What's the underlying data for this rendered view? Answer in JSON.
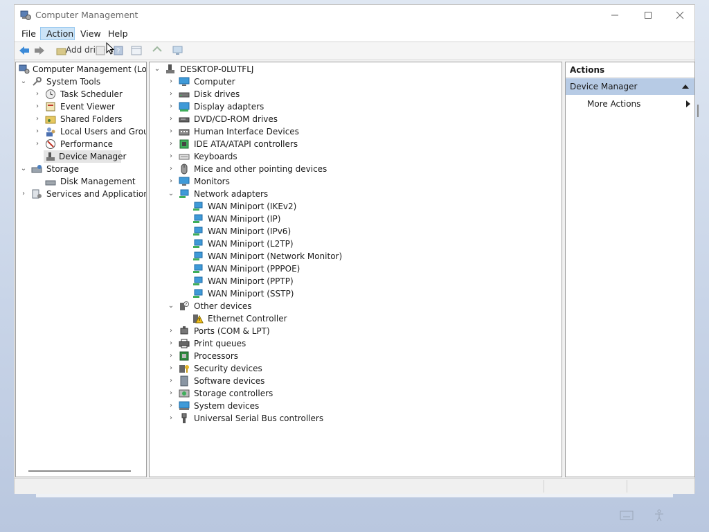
{
  "window": {
    "title": "Computer Management"
  },
  "menu": [
    "File",
    "Action",
    "View",
    "Help"
  ],
  "toolbar": {
    "tooltip": "Add drivers"
  },
  "left_tree": {
    "root": "Computer Management (Local",
    "system_tools": "System Tools",
    "items": [
      "Task Scheduler",
      "Event Viewer",
      "Shared Folders",
      "Local Users and Groups",
      "Performance",
      "Device Manager"
    ],
    "storage": "Storage",
    "disk_management": "Disk Management",
    "services": "Services and Applications"
  },
  "device_tree": {
    "root": "DESKTOP-0LUTFLJ",
    "before_network": [
      "Computer",
      "Disk drives",
      "Display adapters",
      "DVD/CD-ROM drives",
      "Human Interface Devices",
      "IDE ATA/ATAPI controllers",
      "Keyboards",
      "Mice and other pointing devices",
      "Monitors"
    ],
    "network_adapters": "Network adapters",
    "network_children": [
      "WAN Miniport (IKEv2)",
      "WAN Miniport (IP)",
      "WAN Miniport (IPv6)",
      "WAN Miniport (L2TP)",
      "WAN Miniport (Network Monitor)",
      "WAN Miniport (PPPOE)",
      "WAN Miniport (PPTP)",
      "WAN Miniport (SSTP)"
    ],
    "other_devices": "Other devices",
    "other_children": [
      "Ethernet Controller"
    ],
    "after_other": [
      "Ports (COM & LPT)",
      "Print queues",
      "Processors",
      "Security devices",
      "Software devices",
      "Storage controllers",
      "System devices",
      "Universal Serial Bus controllers"
    ]
  },
  "actions": {
    "header": "Actions",
    "selected": "Device Manager",
    "more": "More Actions"
  }
}
